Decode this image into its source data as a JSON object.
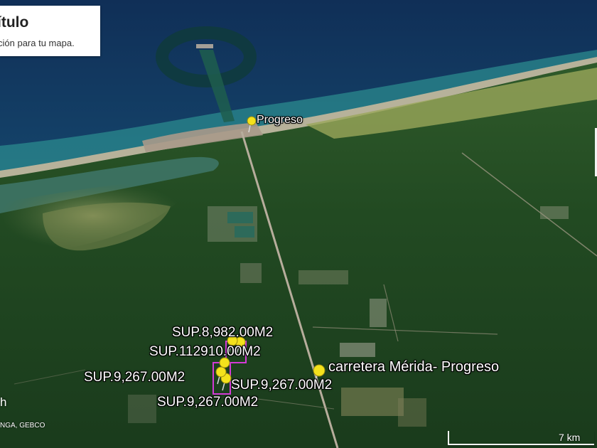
{
  "info_card": {
    "title": "ítulo",
    "description": "ción para tu mapa."
  },
  "placemarks": [
    {
      "id": "progreso",
      "label": "Progreso"
    },
    {
      "id": "sup-8982",
      "label": "SUP.8,982.00M2"
    },
    {
      "id": "sup-112910",
      "label": "SUP.112910.00M2"
    },
    {
      "id": "sup-9267-a",
      "label": "SUP.9,267.00M2"
    },
    {
      "id": "sup-9267-b",
      "label": "SUP.9,267.00M2"
    },
    {
      "id": "sup-9267-c",
      "label": "SUP.9,267.00M2"
    },
    {
      "id": "carretera",
      "label": "carretera Mérida- Progreso"
    }
  ],
  "edge_letter": "h",
  "attribution": "NGA, GEBCO",
  "scale": {
    "label": "7 km"
  },
  "colors": {
    "ocean_deep": "#123e66",
    "ocean_shallow": "#2a7f86",
    "land": "#1f4a22",
    "pin": "#f4e21c",
    "boundary": "#d43ad6"
  },
  "icons": {
    "placemark": "yellow-pushpin-icon"
  }
}
